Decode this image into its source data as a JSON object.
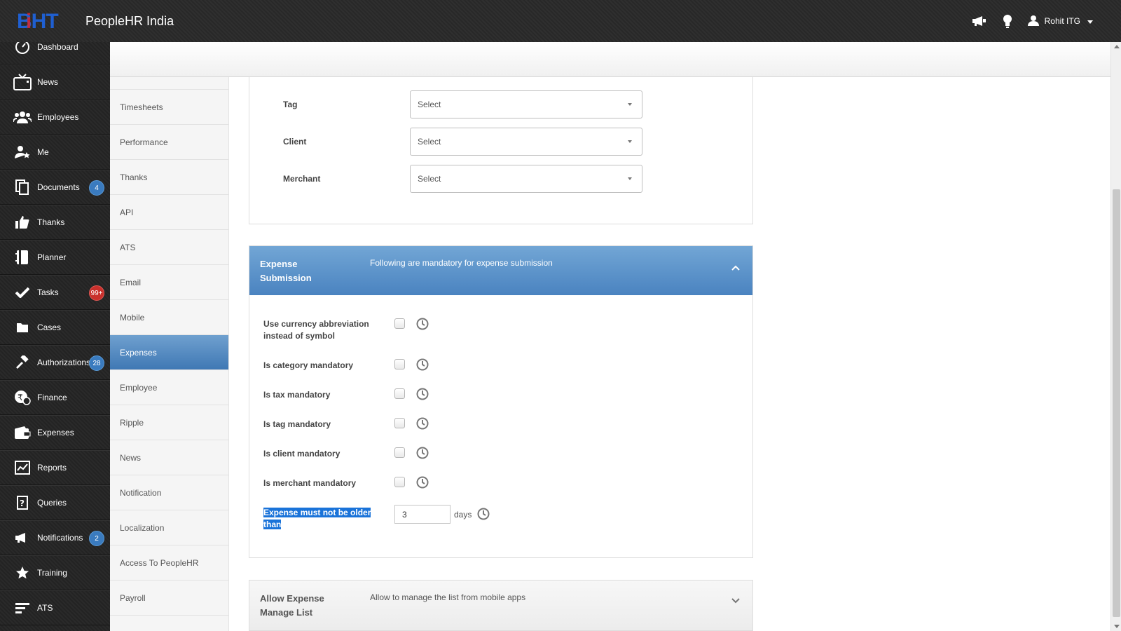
{
  "app": {
    "title": "PeopleHR India",
    "logo_text": "BHT"
  },
  "topbar": {
    "user_name": "Rohit ITG",
    "icons": [
      "megaphone-icon",
      "lightbulb-icon",
      "user-icon",
      "caret-down-icon"
    ]
  },
  "sidebar": {
    "items": [
      {
        "label": "Dashboard",
        "icon": "dashboard-icon"
      },
      {
        "label": "News",
        "icon": "tv-icon"
      },
      {
        "label": "Employees",
        "icon": "users-icon"
      },
      {
        "label": "Me",
        "icon": "user-star-icon"
      },
      {
        "label": "Documents",
        "icon": "documents-icon",
        "badge": "4"
      },
      {
        "label": "Thanks",
        "icon": "thumbs-up-icon"
      },
      {
        "label": "Planner",
        "icon": "planner-icon"
      },
      {
        "label": "Tasks",
        "icon": "check-icon",
        "badge": "99+"
      },
      {
        "label": "Cases",
        "icon": "folder-icon"
      },
      {
        "label": "Authorizations",
        "icon": "gavel-icon",
        "badge": "28"
      },
      {
        "label": "Finance",
        "icon": "rupee-icon"
      },
      {
        "label": "Expenses",
        "icon": "wallet-icon"
      },
      {
        "label": "Reports",
        "icon": "chart-icon"
      },
      {
        "label": "Queries",
        "icon": "question-icon"
      },
      {
        "label": "Notifications",
        "icon": "megaphone-icon",
        "badge": "2"
      },
      {
        "label": "Training",
        "icon": "star-icon"
      },
      {
        "label": "ATS",
        "icon": "bars-icon"
      }
    ]
  },
  "submenu": {
    "items": [
      "Timesheets",
      "Performance",
      "Thanks",
      "API",
      "ATS",
      "Email",
      "Mobile",
      "Expenses",
      "Employee",
      "Ripple",
      "News",
      "Notification",
      "Localization",
      "Access To PeopleHR",
      "Payroll"
    ],
    "active": "Expenses"
  },
  "form": {
    "tag_label": "Tag",
    "tag_value": "Select",
    "client_label": "Client",
    "client_value": "Select",
    "merchant_label": "Merchant",
    "merchant_value": "Select"
  },
  "expense_submission": {
    "title": "Expense Submission",
    "description": "Following are mandatory for expense submission",
    "options": [
      "Use currency abbreviation instead of symbol",
      "Is category mandatory",
      "Is tax mandatory",
      "Is tag mandatory",
      "Is client mandatory",
      "Is merchant mandatory"
    ],
    "age_label": "Expense must not be older than",
    "age_value": "3",
    "age_unit": "days"
  },
  "manage_list": {
    "title": "Allow Expense Manage List",
    "description": "Allow to manage the list from mobile apps"
  },
  "colors": {
    "accent": "#4a83c0",
    "badge_blue": "#3a7bbf",
    "badge_red": "#c9302c",
    "topbar": "#2b2b2b"
  }
}
